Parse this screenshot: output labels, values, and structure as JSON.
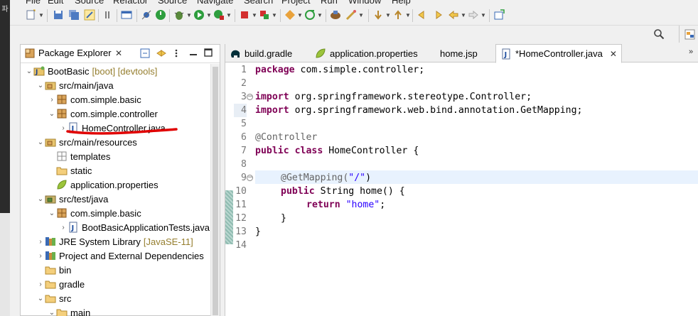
{
  "window": {
    "left_strip_label": "파"
  },
  "menu": {
    "items": [
      "File",
      "Edit",
      "Source",
      "Refactor",
      "Source",
      "Navigate",
      "Search",
      "Project",
      "Run",
      "Window",
      "Help"
    ]
  },
  "package_explorer": {
    "title": "Package Explorer",
    "tree": [
      {
        "label": "BootBasic",
        "deco": "[boot] [devtools]",
        "icon": "project-icon"
      },
      {
        "label": "src/main/java",
        "icon": "source-folder-icon"
      },
      {
        "label": "com.simple.basic",
        "icon": "package-icon"
      },
      {
        "label": "com.simple.controller",
        "icon": "package-icon"
      },
      {
        "label": "HomeController.java",
        "icon": "java-file-icon"
      },
      {
        "label": "src/main/resources",
        "icon": "source-folder-icon"
      },
      {
        "label": "templates",
        "icon": "empty-package-icon"
      },
      {
        "label": "static",
        "icon": "folder-icon"
      },
      {
        "label": "application.properties",
        "icon": "properties-file-icon"
      },
      {
        "label": "src/test/java",
        "icon": "test-source-folder-icon"
      },
      {
        "label": "com.simple.basic",
        "icon": "package-icon"
      },
      {
        "label": "BootBasicApplicationTests.java",
        "icon": "java-file-icon"
      },
      {
        "label": "JRE System Library",
        "deco": "[JavaSE-11]",
        "icon": "library-icon"
      },
      {
        "label": "Project and External Dependencies",
        "icon": "library-icon"
      },
      {
        "label": "bin",
        "icon": "folder-icon"
      },
      {
        "label": "gradle",
        "icon": "folder-icon"
      },
      {
        "label": "src",
        "icon": "folder-icon"
      },
      {
        "label": "main",
        "icon": "folder-icon"
      }
    ]
  },
  "editor": {
    "tabs": [
      {
        "label": "build.gradle",
        "icon": "gradle-elephant-icon"
      },
      {
        "label": "application.properties",
        "icon": "properties-file-icon"
      },
      {
        "label": "home.jsp",
        "icon": ""
      },
      {
        "label": "*HomeController.java",
        "icon": "java-file-icon",
        "active": true
      }
    ],
    "line_numbers": [
      "1",
      "2",
      "3",
      "4",
      "5",
      "6",
      "7",
      "8",
      "9",
      "10",
      "11",
      "12",
      "13",
      "14"
    ],
    "code": {
      "l1_kw": "package",
      "l1_rest": " com.simple.controller;",
      "l3_kw": "import",
      "l3_rest": " org.springframework.stereotype.Controller;",
      "l4_kw": "import",
      "l4_rest": " org.springframework.web.bind.annotation.GetMapping;",
      "l6_ann": "@Controller",
      "l7_kw": "public class",
      "l7_rest": " HomeController {",
      "l9_ann": "@GetMapping(",
      "l9_str": "\"/\"",
      "l9_end": ")",
      "l10_kw": "public",
      "l10_rest": " String home() {",
      "l11_kw": "return",
      "l11_str": "\"home\"",
      "l11_end": ";",
      "l12": "}",
      "l13": "}"
    }
  },
  "colors": {
    "keyword": "#7f0055",
    "string": "#2a00ff",
    "annotation": "#646464",
    "highlight_underline": "#e00000"
  }
}
